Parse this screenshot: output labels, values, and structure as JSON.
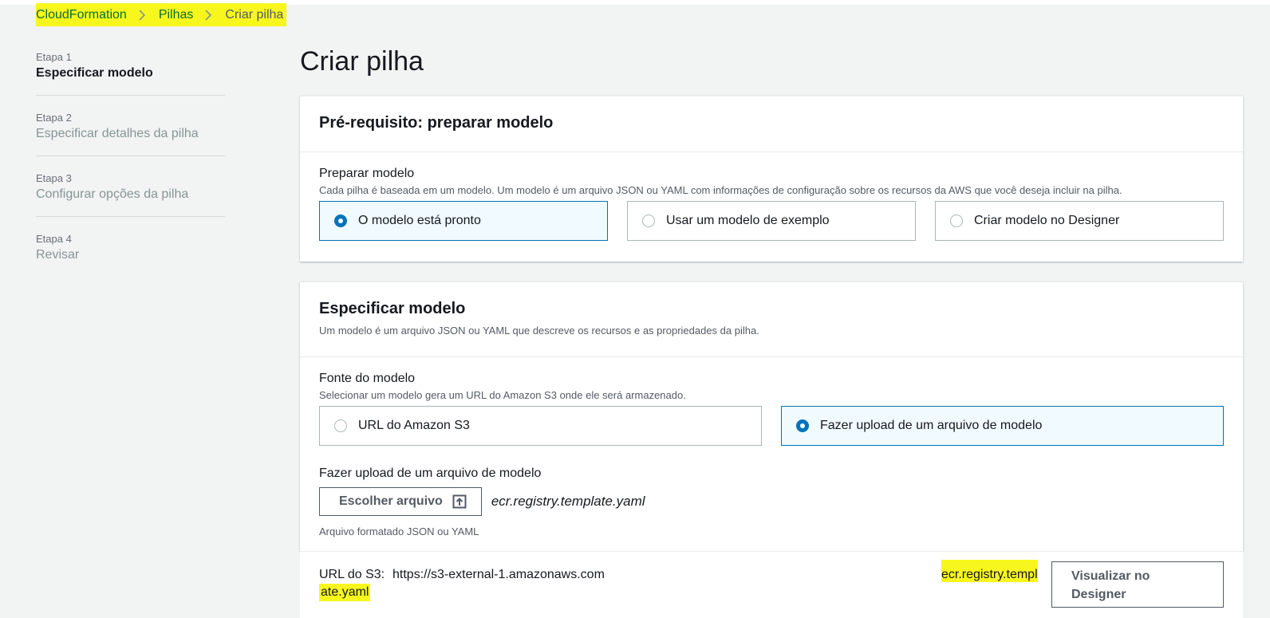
{
  "breadcrumb": {
    "items": [
      "CloudFormation",
      "Pilhas"
    ],
    "current": "Criar pilha"
  },
  "steps": [
    {
      "num": "Etapa 1",
      "name": "Especificar modelo",
      "active": true
    },
    {
      "num": "Etapa 2",
      "name": "Especificar detalhes da pilha",
      "active": false
    },
    {
      "num": "Etapa 3",
      "name": "Configurar opções da pilha",
      "active": false
    },
    {
      "num": "Etapa 4",
      "name": "Revisar",
      "active": false
    }
  ],
  "page": {
    "title": "Criar pilha"
  },
  "prereq": {
    "title": "Pré-requisito: preparar modelo",
    "label": "Preparar modelo",
    "description": "Cada pilha é baseada em um modelo. Um modelo é um arquivo JSON ou YAML com informações de configuração sobre os recursos da AWS que você deseja incluir na pilha.",
    "options": [
      "O modelo está pronto",
      "Usar um modelo de exemplo",
      "Criar modelo no Designer"
    ],
    "selected": "O modelo está pronto"
  },
  "spec": {
    "title": "Especificar modelo",
    "description": "Um modelo é um arquivo JSON ou YAML que descreve os recursos e as propriedades da pilha.",
    "source_label": "Fonte do modelo",
    "source_description": "Selecionar um modelo gera um URL do Amazon S3 onde ele será armazenado.",
    "options": [
      "URL do Amazon S3",
      "Fazer upload de um arquivo de modelo"
    ],
    "selected": "Fazer upload de um arquivo de modelo",
    "upload_label": "Fazer upload de um arquivo de modelo",
    "choose_button": "Escolher arquivo",
    "filename": "ecr.registry.template.yaml",
    "hint": "Arquivo formatado JSON ou YAML",
    "s3_label": "URL do S3:",
    "s3_url_visible": "https://s3-external-1.amazonaws.com",
    "s3_url_end_line1": "ecr.registry.templ",
    "s3_url_end_line2": "ate.yaml",
    "view_designer_button": "Visualizar no Designer"
  },
  "colors": {
    "accent": "#0073bb",
    "highlight": "#f7f71e",
    "breadcrumb_link": "#0b6b2e"
  },
  "icons": {
    "breadcrumb_separator": "chevron-right-icon",
    "upload": "upload-icon"
  }
}
